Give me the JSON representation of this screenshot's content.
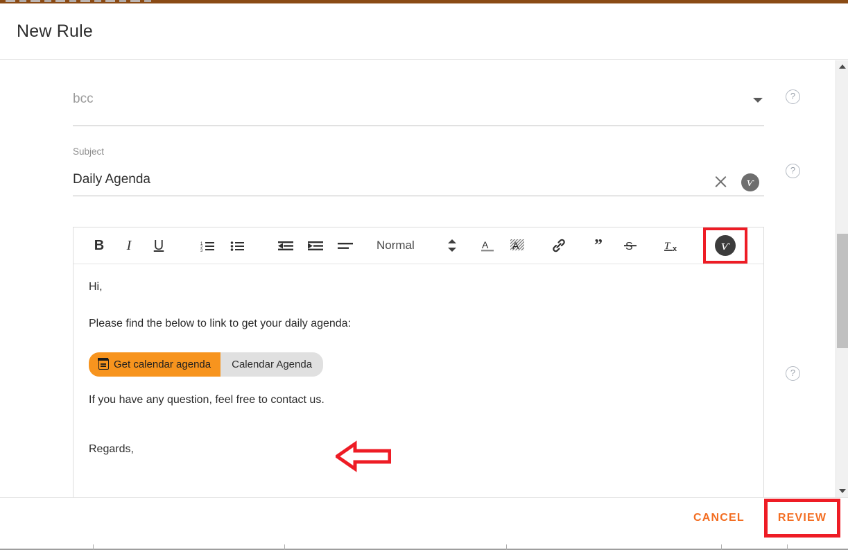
{
  "dialog": {
    "title": "New Rule"
  },
  "form": {
    "bcc": {
      "name": "bcc",
      "placeholder": "bcc",
      "value": "",
      "caret_icon": "chevron-down-icon"
    },
    "subject": {
      "label": "Subject",
      "value": "Daily Agenda",
      "clear_icon": "close-icon",
      "variable_icon": "v-badge-icon",
      "variable_glyph": "ѵ"
    }
  },
  "help": {
    "glyph": "?",
    "icons": [
      "help-icon-bcc",
      "help-icon-subject",
      "help-icon-editor"
    ]
  },
  "editor": {
    "toolbar": {
      "bold": "B",
      "italic": "I",
      "underline": "U",
      "ordered_list": "ordered-list-icon",
      "bullet_list": "bullet-list-icon",
      "outdent": "outdent-icon",
      "indent": "indent-icon",
      "align": "align-icon",
      "style_select": "Normal",
      "text_color": "A",
      "background_color": "A",
      "link": "link-icon",
      "blockquote": "”",
      "strikethrough": "S",
      "clear_format": "T",
      "clear_format_sub": "x",
      "variable_button": "v-badge-icon",
      "variable_glyph": "ѵ"
    },
    "content": {
      "greeting": "Hi,",
      "intro": "Please find the below to link to get your daily agenda:",
      "pill": {
        "icon": "calendar-icon",
        "action_label": "Get calendar agenda",
        "value_label": "Calendar Agenda",
        "action_bg": "#f7941e",
        "value_bg": "#e0e0e0"
      },
      "closing": "If you have any question, feel free to contact us.",
      "signoff": "Regards,"
    }
  },
  "annotations": {
    "arrow_color": "#ee1c25",
    "highlight_color": "#ee1c25",
    "highlighted": [
      "toolbar-variable-button",
      "review-button"
    ]
  },
  "scrollbar": {
    "up_icon": "scroll-up-arrow-icon",
    "down_icon": "scroll-down-arrow-icon"
  },
  "footer": {
    "cancel_label": "CANCEL",
    "review_label": "REVIEW",
    "accent_color": "#f36d21"
  }
}
